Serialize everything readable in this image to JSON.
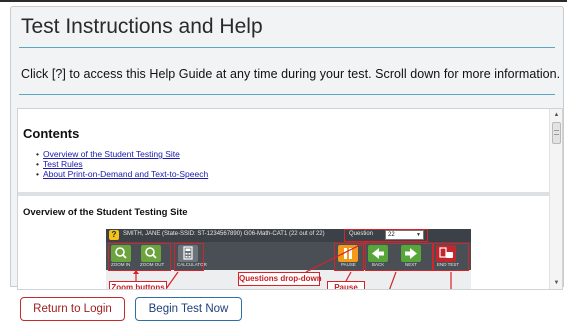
{
  "header": {
    "title": "Test Instructions and Help",
    "intro": "Click [?] to access this Help Guide at any time during your test. Scroll down for more information."
  },
  "contents": {
    "heading": "Contents",
    "items": [
      "Overview of the Student Testing Site",
      "Test Rules",
      "About Print-on-Demand and Text-to-Speech"
    ]
  },
  "overview": {
    "heading": "Overview of the Student Testing Site",
    "illustration": {
      "help_icon": "?",
      "student_info": "SMITH, JANE (State-SSID: ST-1234567890)  G06-Math-CAT1 (22 out of 22)",
      "question_label": "Question",
      "question_value": "22",
      "tools": {
        "zoom_in": "ZOOM IN",
        "zoom_out": "ZOOM OUT",
        "calculator": "CALCULATOR",
        "pause": "PAUSE",
        "back": "BACK",
        "next": "NEXT",
        "end_test": "END TEST"
      },
      "callouts": {
        "zoom": "Zoom buttons",
        "questions_dropdown": "Questions drop-down",
        "pause": "Pause"
      }
    }
  },
  "footer": {
    "return_label": "Return to Login",
    "begin_label": "Begin Test Now"
  },
  "colors": {
    "accent_rule": "#58a8bf",
    "link": "#1a1ab0",
    "return_border": "#c52b2b",
    "begin_border": "#2e6fa6",
    "callout_red": "#d4242a"
  }
}
